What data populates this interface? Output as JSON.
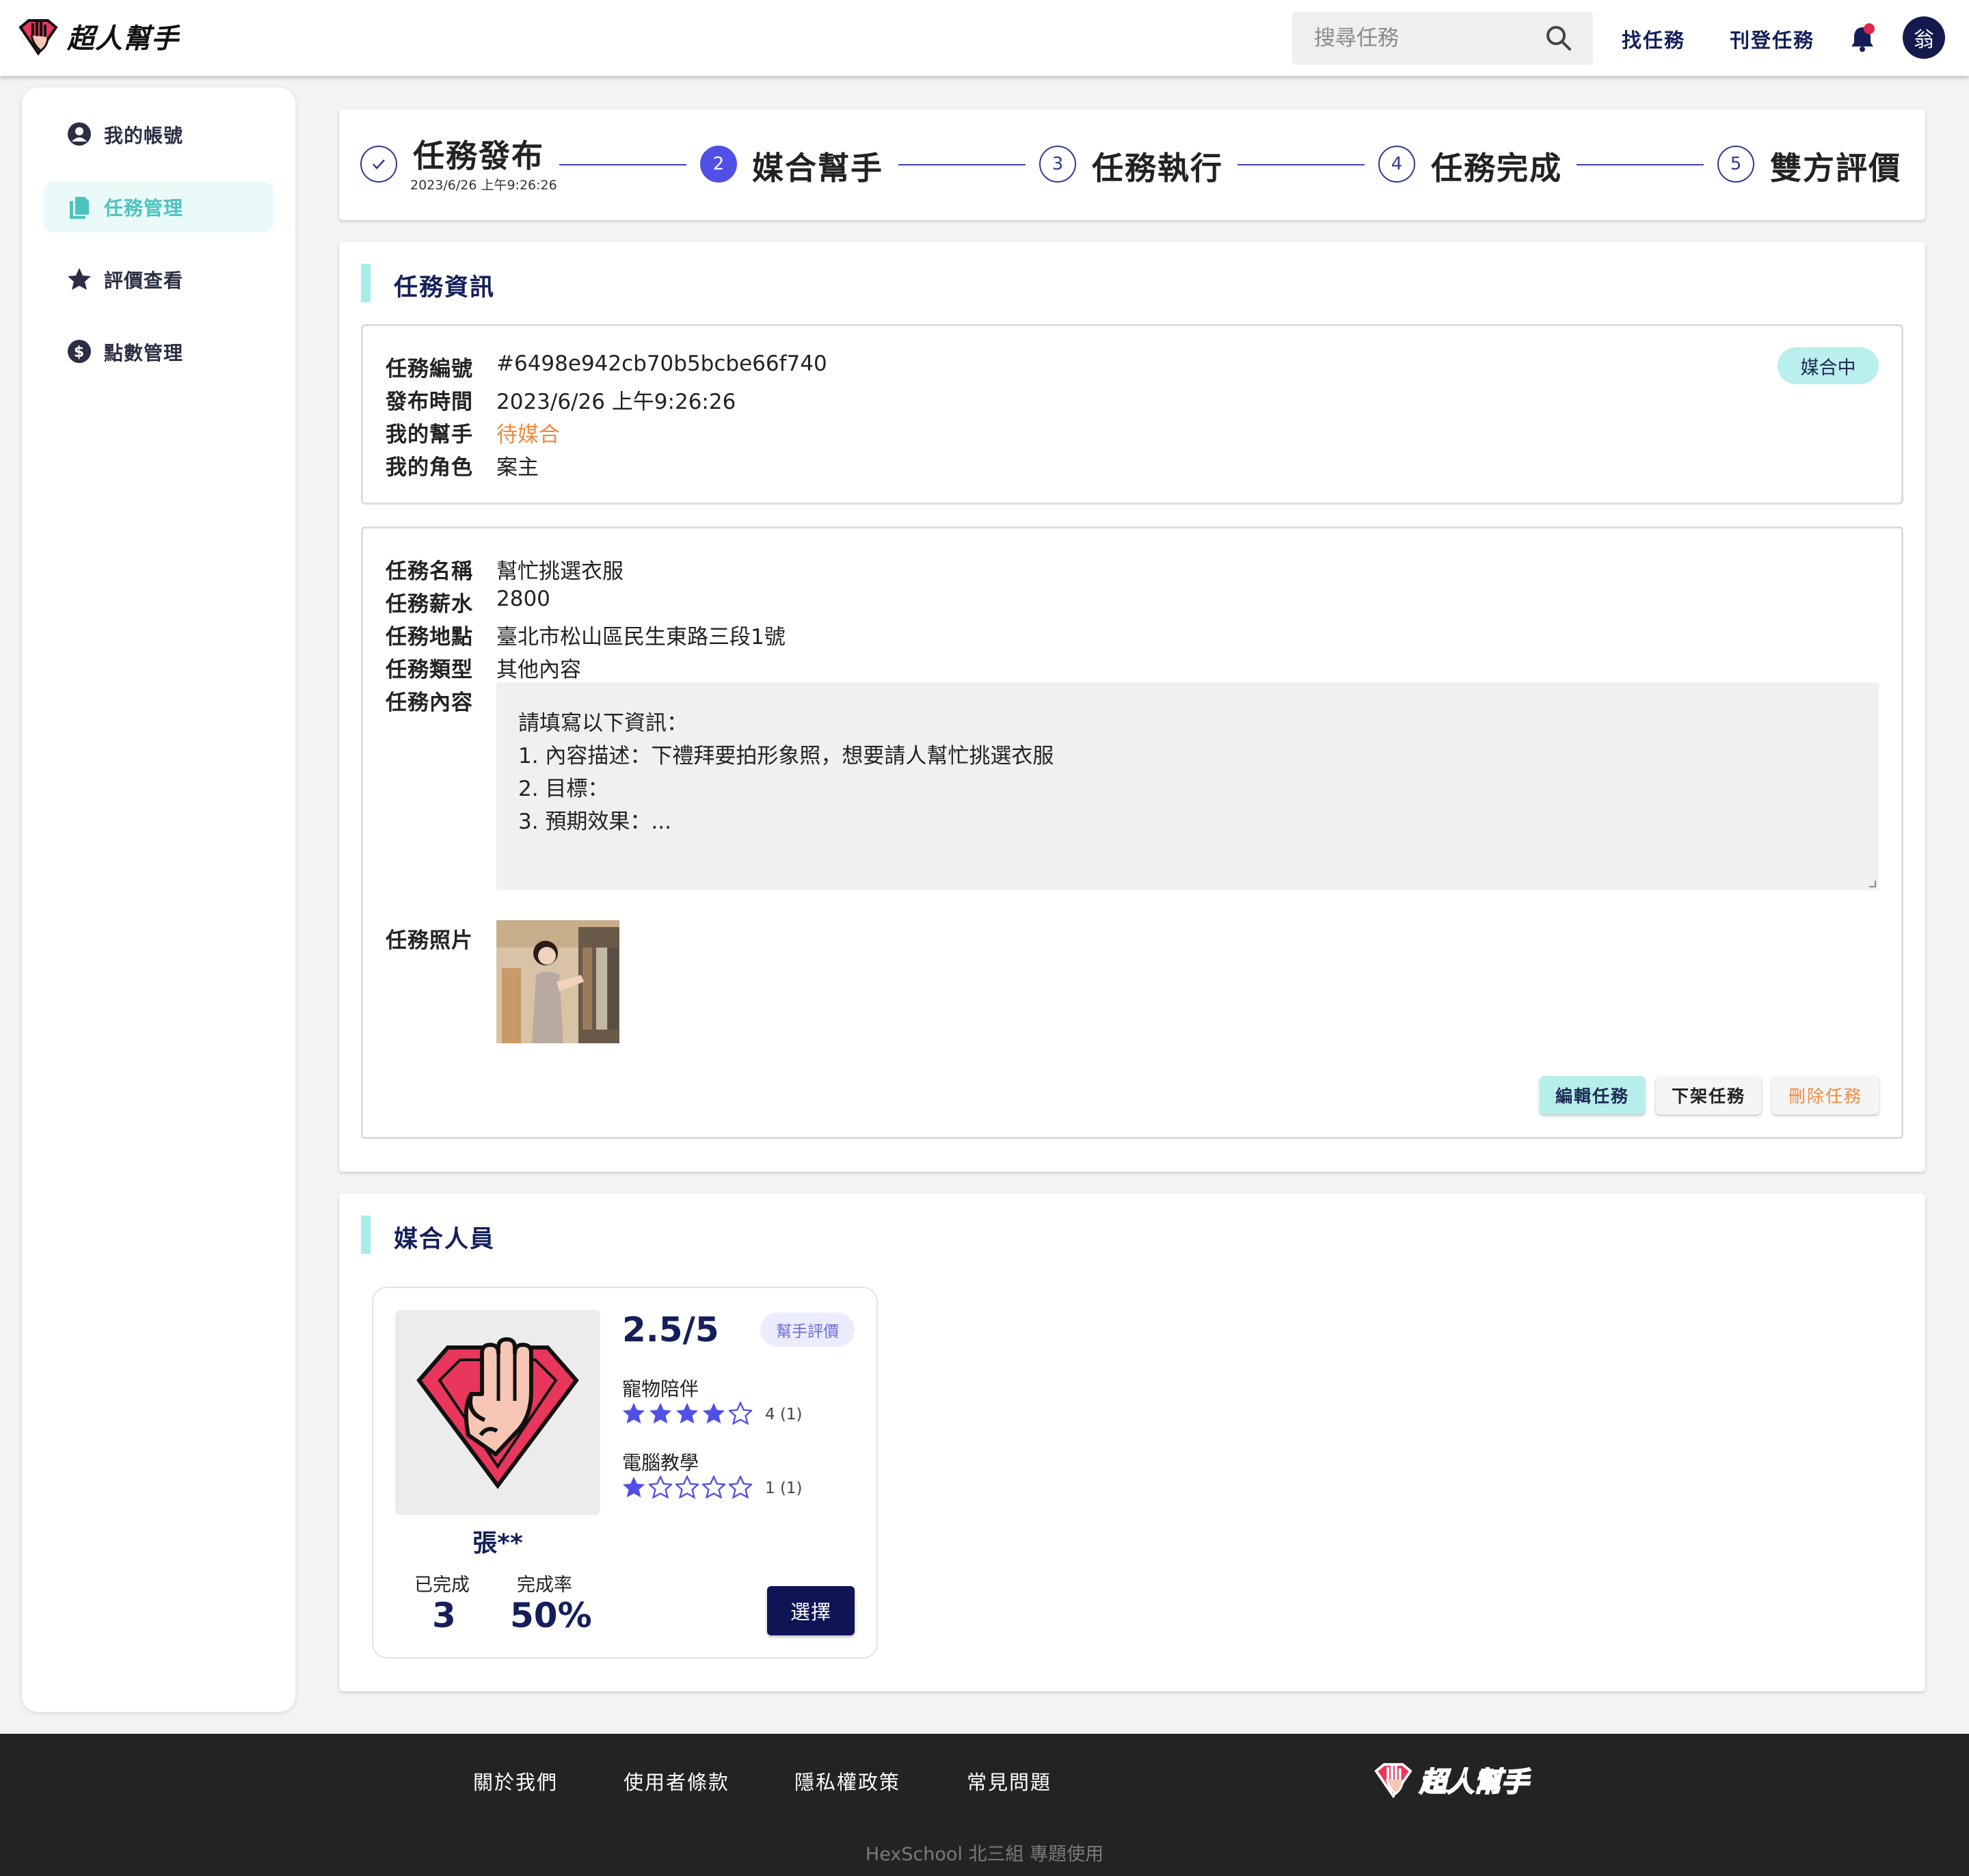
{
  "header": {
    "logo_text": "超人幫手",
    "search_placeholder": "搜尋任務",
    "nav": [
      "找任務",
      "刊登任務"
    ],
    "avatar_initial": "翁"
  },
  "sidebar": {
    "items": [
      {
        "label": "我的帳號",
        "icon": "user-circle-icon",
        "active": false
      },
      {
        "label": "任務管理",
        "icon": "documents-icon",
        "active": true
      },
      {
        "label": "評價查看",
        "icon": "star-icon",
        "active": false
      },
      {
        "label": "點數管理",
        "icon": "dollar-circle-icon",
        "active": false
      }
    ]
  },
  "steps": [
    {
      "num": "✓",
      "label": "任務發布",
      "date": "2023/6/26 上午9:26:26",
      "state": "done"
    },
    {
      "num": "2",
      "label": "媒合幫手",
      "state": "active"
    },
    {
      "num": "3",
      "label": "任務執行",
      "state": "todo"
    },
    {
      "num": "4",
      "label": "任務完成",
      "state": "todo"
    },
    {
      "num": "5",
      "label": "雙方評價",
      "state": "todo"
    }
  ],
  "task_info": {
    "title": "任務資訊",
    "status": "媒合中",
    "meta": [
      {
        "key": "任務編號",
        "value": "#6498e942cb70b5bcbe66f740"
      },
      {
        "key": "發布時間",
        "value": "2023/6/26 上午9:26:26"
      },
      {
        "key": "我的幫手",
        "value": "待媒合"
      },
      {
        "key": "我的角色",
        "value": "案主"
      }
    ],
    "details": [
      {
        "key": "任務名稱",
        "value": "幫忙挑選衣服"
      },
      {
        "key": "任務薪水",
        "value": "2800"
      },
      {
        "key": "任務地點",
        "value": "臺北市松山區民生東路三段1號"
      },
      {
        "key": "任務類型",
        "value": "其他內容"
      }
    ],
    "content_label": "任務內容",
    "content_lines": [
      "請填寫以下資訊：",
      "1. 內容描述：下禮拜要拍形象照，想要請人幫忙挑選衣服",
      "2. 目標：",
      "3. 預期效果：..."
    ],
    "photo_label": "任務照片",
    "buttons": {
      "edit": "編輯任務",
      "unlist": "下架任務",
      "delete": "刪除任務"
    }
  },
  "match": {
    "title": "媒合人員",
    "helper": {
      "name": "張**",
      "completed_label": "已完成",
      "completed": "3",
      "rate_label": "完成率",
      "rate": "50%",
      "rating": "2.5/5",
      "rating_badge": "幫手評價",
      "skills": [
        {
          "name": "寵物陪伴",
          "stars": 4,
          "count": "4 (1)"
        },
        {
          "name": "電腦教學",
          "stars": 1,
          "count": "1 (1)"
        }
      ],
      "select_label": "選擇"
    }
  },
  "footer": {
    "links": [
      "關於我們",
      "使用者條款",
      "隱私權政策",
      "常見問題"
    ],
    "logo_text": "超人幫手",
    "copyright": "HexSchool 北三組 專題使用"
  },
  "colors": {
    "navy": "#141f5a",
    "teal": "#4cc3bf",
    "teal_light": "#b9efec",
    "step_active": "#5050e6",
    "orange": "#f08a3e",
    "footer_bg": "#232325",
    "star": "#5050e6"
  }
}
